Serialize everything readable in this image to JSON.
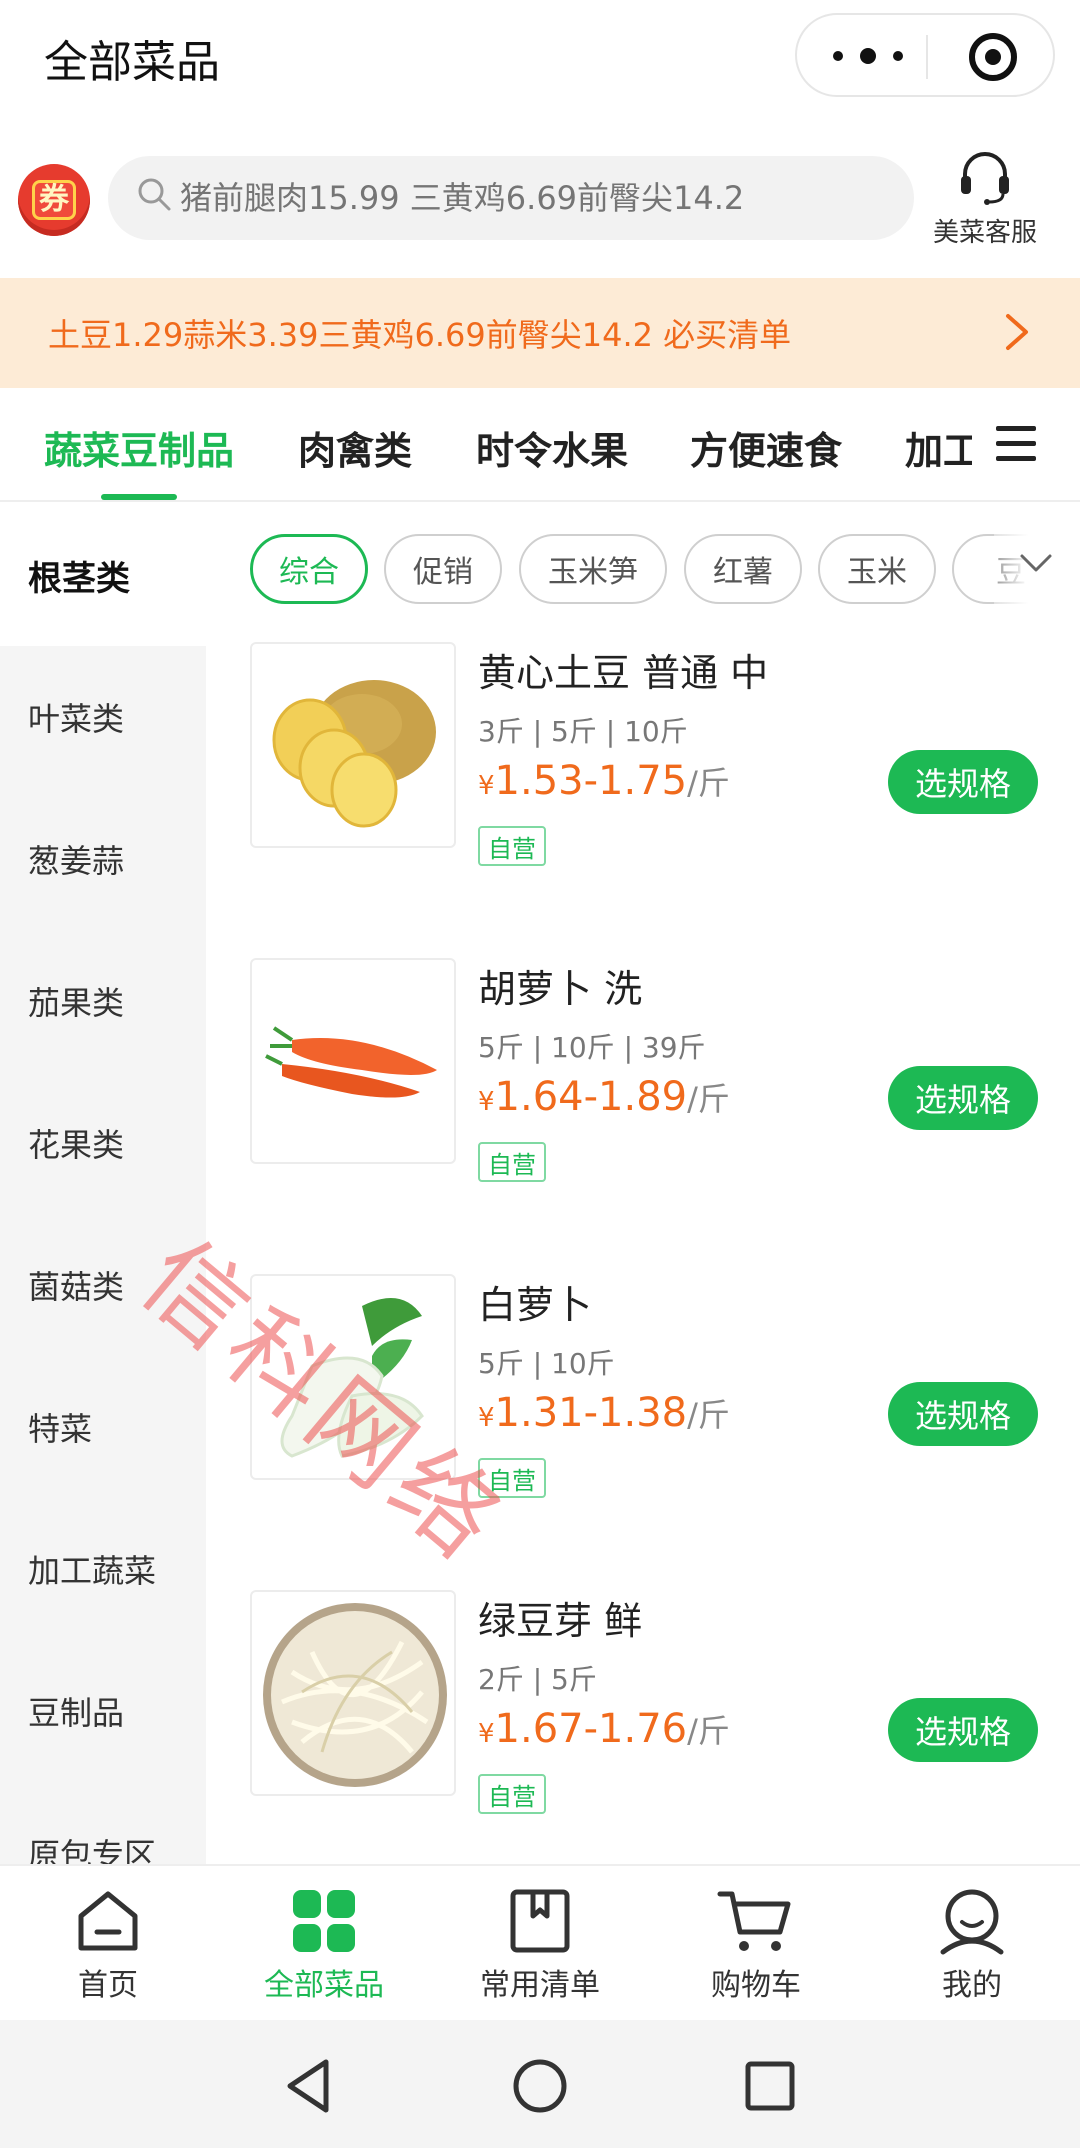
{
  "header": {
    "title": "全部菜品"
  },
  "search": {
    "coupon_label": "券",
    "placeholder": "猪前腿肉15.99 三黄鸡6.69前臀尖14.2",
    "service_label": "美菜客服"
  },
  "banner": {
    "text": "土豆1.29蒜米3.39三黄鸡6.69前臀尖14.2 必买清单"
  },
  "category_tabs": [
    "蔬菜豆制品",
    "肉禽类",
    "时令水果",
    "方便速食",
    "加工"
  ],
  "sidebar": {
    "items": [
      "根茎类",
      "叶菜类",
      "葱姜蒜",
      "茄果类",
      "花果类",
      "菌菇类",
      "特菜",
      "加工蔬菜",
      "豆制品",
      "原包专区"
    ]
  },
  "chips": [
    "综合",
    "促销",
    "玉米笋",
    "红薯",
    "玉米",
    "豆"
  ],
  "products": [
    {
      "name": "黄心土豆 普通 中",
      "specs": "3斤 | 5斤 | 10斤",
      "currency": "¥",
      "price": "1.53-1.75",
      "unit": "/斤",
      "tag": "自营",
      "button": "选规格"
    },
    {
      "name": "胡萝卜 洗",
      "specs": "5斤 | 10斤 | 39斤",
      "currency": "¥",
      "price": "1.64-1.89",
      "unit": "/斤",
      "tag": "自营",
      "button": "选规格"
    },
    {
      "name": "白萝卜",
      "specs": "5斤 | 10斤",
      "currency": "¥",
      "price": "1.31-1.38",
      "unit": "/斤",
      "tag": "自营",
      "button": "选规格"
    },
    {
      "name": "绿豆芽 鲜",
      "specs": "2斤 | 5斤",
      "currency": "¥",
      "price": "1.67-1.76",
      "unit": "/斤",
      "tag": "自营",
      "button": "选规格"
    }
  ],
  "watermark": "信科网络",
  "tabbar": [
    "首页",
    "全部菜品",
    "常用清单",
    "购物车",
    "我的"
  ],
  "colors": {
    "accent": "#1db954",
    "price": "#f06a1c",
    "banner_bg": "#fdebd6"
  },
  "icons": [
    "search-icon",
    "headset-icon",
    "chevron-right-icon",
    "menu-icon",
    "chevron-down-icon",
    "home-icon",
    "grid-icon",
    "bookmark-icon",
    "cart-icon",
    "user-icon",
    "back-icon",
    "home-circle-icon",
    "recents-icon"
  ]
}
